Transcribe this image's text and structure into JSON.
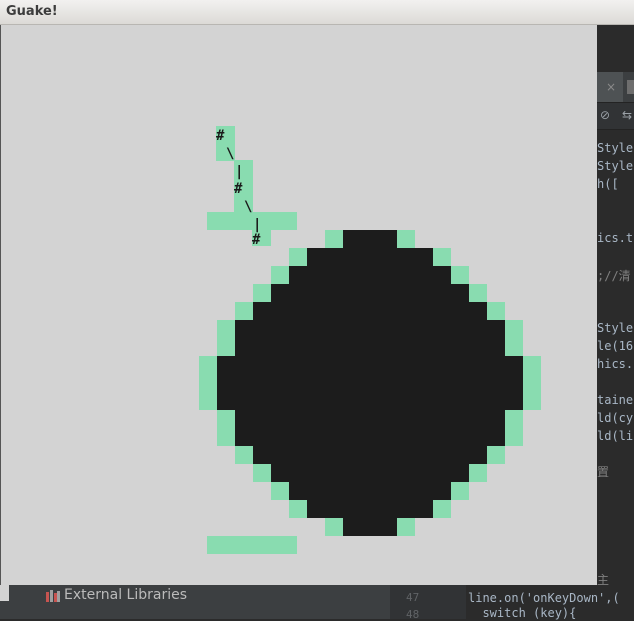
{
  "window": {
    "title": "Guake!"
  },
  "ide": {
    "tab_close": "×",
    "code_right": [
      {
        "text": "Style"
      },
      {
        "text": "Style"
      },
      {
        "text": "h(["
      },
      {
        "text": "ics.t"
      },
      {
        "text": ";//清"
      },
      {
        "text": "Style"
      },
      {
        "text": "le(16"
      },
      {
        "text": "hics."
      },
      {
        "text": "taine"
      },
      {
        "text": "ld(cy"
      },
      {
        "text": "ld(li"
      },
      {
        "text": "置"
      },
      {
        "text": "主"
      }
    ],
    "line_numbers": [
      "47",
      "48"
    ],
    "code_bottom": [
      "line.on('onKeyDown',(",
      "  switch (key){"
    ],
    "project_panel": {
      "item_label": "External Libraries"
    }
  },
  "game": {
    "colors": {
      "background": "#d3d3d3",
      "ball": "#1c1c1c",
      "outline": "#89dcb0",
      "glyph": "#1a1a1a"
    },
    "ascii_glyphs": [
      "#",
      "\\",
      "|",
      "#",
      "\\",
      "|",
      "#"
    ]
  }
}
